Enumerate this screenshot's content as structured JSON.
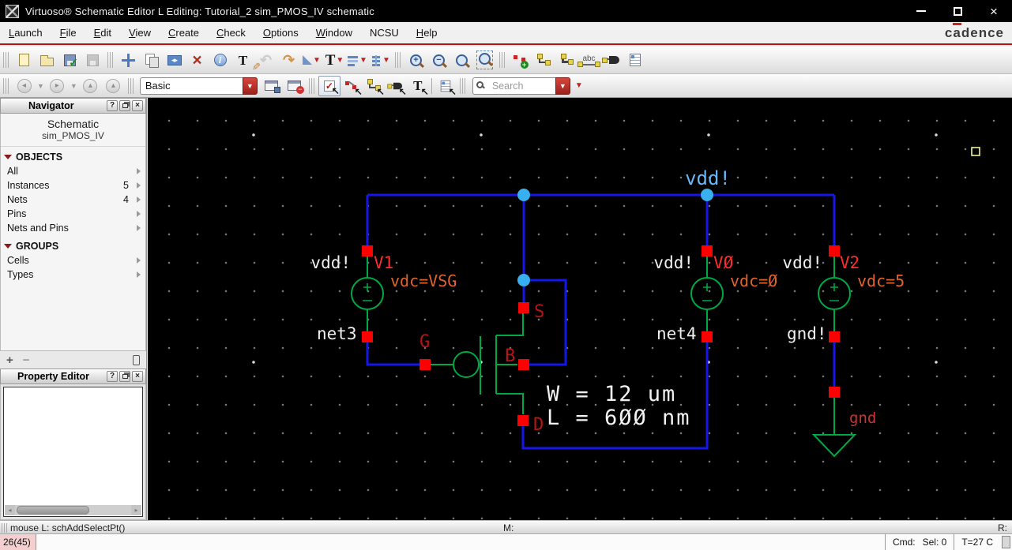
{
  "window": {
    "title": "Virtuoso® Schematic Editor L Editing: Tutorial_2 sim_PMOS_IV schematic",
    "close_glyph": "×"
  },
  "menubar": {
    "items": [
      {
        "label": "Launch"
      },
      {
        "label": "File"
      },
      {
        "label": "Edit"
      },
      {
        "label": "View"
      },
      {
        "label": "Create"
      },
      {
        "label": "Check"
      },
      {
        "label": "Options"
      },
      {
        "label": "Window"
      },
      {
        "label": "NCSU"
      },
      {
        "label": "Help"
      }
    ],
    "logo": {
      "left": "c",
      "accent": "a",
      "right": "dence"
    }
  },
  "toolbar1": {
    "icons": [
      "new",
      "open",
      "save",
      "save-disabled",
      "move",
      "copy",
      "stretch",
      "delete",
      "query-object-properties",
      "edit-properties",
      "undo",
      "redo",
      "rotate",
      "text-style",
      "align",
      "distribute",
      "zoom-in",
      "zoom-out",
      "zoom-to-fit",
      "zoom-to-selected",
      "create-instance",
      "create-wire",
      "create-wide-wire",
      "create-wire-name",
      "create-pin",
      "create-note"
    ],
    "stretch_glyphs": "◂▸",
    "info_glyph": "i",
    "text_tool": "T",
    "pencil_glyph": "✎",
    "undo_glyph": "↶",
    "redo_glyph": "↷",
    "zoom_in_glyph": "+",
    "zoom_out_glyph": "−",
    "wire_name_label": "abc"
  },
  "toolbar2": {
    "icons": [
      "back",
      "back-menu",
      "forward",
      "forward-menu",
      "up",
      "top",
      "workspace-combo",
      "save-workspace",
      "delete-workspace",
      "select-mode",
      "partial-select-mode",
      "wire-select-mode",
      "pin-select-mode",
      "label-select-mode",
      "property-select-mode",
      "search"
    ],
    "workspace": "Basic",
    "select_check": "✓",
    "label_mode_letter": "T",
    "search_placeholder": "Search"
  },
  "navigator": {
    "title": "Navigator",
    "help": "?",
    "close": "×",
    "view": "Schematic",
    "cell": "sim_PMOS_IV",
    "sections": [
      {
        "label": "OBJECTS",
        "items": [
          {
            "label": "All",
            "count": ""
          },
          {
            "label": "Instances",
            "count": "5"
          },
          {
            "label": "Nets",
            "count": "4"
          },
          {
            "label": "Pins",
            "count": ""
          },
          {
            "label": "Nets and Pins",
            "count": ""
          }
        ]
      },
      {
        "label": "GROUPS",
        "items": [
          {
            "label": "Cells",
            "count": ""
          },
          {
            "label": "Types",
            "count": ""
          }
        ]
      }
    ],
    "add": "+",
    "remove": "−"
  },
  "property_editor": {
    "title": "Property Editor",
    "help": "?",
    "close": "×"
  },
  "schematic": {
    "rail_net": "vdd!",
    "v1": {
      "flag": "vdd!",
      "name": "V1",
      "value": "vdc=VSG",
      "net_below": "net3"
    },
    "v0": {
      "flag": "vdd!",
      "name": "VØ",
      "value": "vdc=Ø",
      "net_below": "net4"
    },
    "v2": {
      "flag": "vdd!",
      "name": "V2",
      "value": "vdc=5",
      "net_below": "gnd!",
      "gnd_label": "gnd"
    },
    "mosfet": {
      "gate": "G",
      "source": "S",
      "bulk": "B",
      "drain": "D",
      "width": "W = 12 um",
      "length": "L = 6ØØ nm"
    }
  },
  "statusbar": {
    "left": "mouse L: schAddSelectPt()",
    "middle": "M:",
    "right": "R:"
  },
  "bottombar": {
    "badge": "26(45)",
    "cmd_label": "Cmd:",
    "sel_label": "Sel: 0",
    "temp_label": "T=27 C"
  }
}
